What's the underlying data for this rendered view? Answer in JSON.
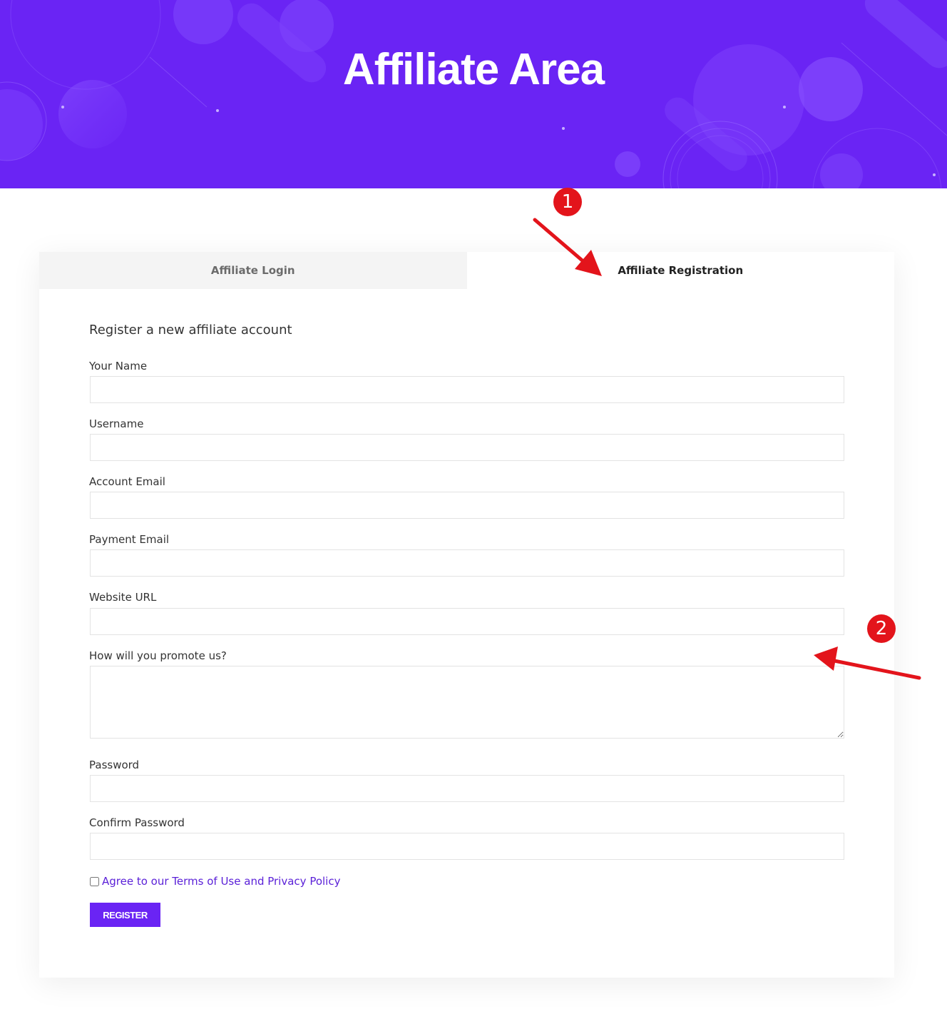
{
  "hero": {
    "title": "Affiliate Area",
    "background_color": "#6a24f4"
  },
  "tabs": [
    {
      "label": "Affiliate Login",
      "active": false
    },
    {
      "label": "Affiliate Registration",
      "active": true
    }
  ],
  "form": {
    "heading": "Register a new affiliate account",
    "fields": {
      "name": {
        "label": "Your Name",
        "value": ""
      },
      "username": {
        "label": "Username",
        "value": ""
      },
      "account_email": {
        "label": "Account Email",
        "value": ""
      },
      "payment_email": {
        "label": "Payment Email",
        "value": ""
      },
      "website_url": {
        "label": "Website URL",
        "value": ""
      },
      "promote": {
        "label": "How will you promote us?",
        "value": ""
      },
      "password": {
        "label": "Password",
        "value": ""
      },
      "confirm_password": {
        "label": "Confirm Password",
        "value": ""
      }
    },
    "agree": {
      "label": "Agree to our Terms of Use and Privacy Policy",
      "checked": false
    },
    "submit_label": "REGISTER"
  },
  "annotations": {
    "badge_1": "1",
    "badge_2": "2",
    "color": "#e3141b"
  },
  "colors": {
    "accent": "#6a24f4",
    "link": "#5b21d8"
  }
}
